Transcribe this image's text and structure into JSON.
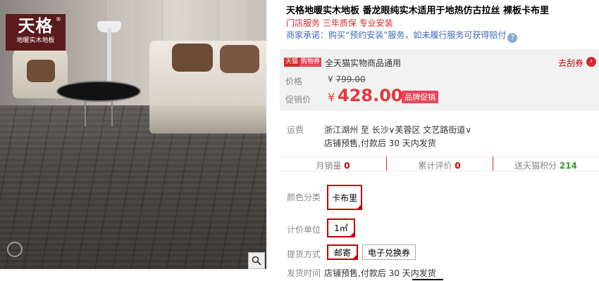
{
  "gallery": {
    "logo_main": "天格",
    "logo_sub": "地暖实木地板",
    "logo_reg": "®",
    "zoom_icon": "magnifier-icon"
  },
  "product": {
    "title": "天格地暖实木地板 番龙眼纯实木适用于地热仿古拉丝 裸板卡布里",
    "subtitle": "门店服务 三年质保 专业安装",
    "promise": "商家承诺：购买“预约安装”服务，如未履行服务可获得赔付",
    "help_icon": "?"
  },
  "price": {
    "badge_a": "天猫",
    "badge_b": "购物券",
    "coupon_text": "全天猫实物商品通用",
    "coupon_link": "去刮券",
    "coupon_arrow": "›",
    "label_price": "价格",
    "currency": "¥",
    "old_price": "799.00",
    "label_promo": "促销价",
    "promo_price": "428.00",
    "promo_tag": "品牌促销"
  },
  "shipping": {
    "label": "运费",
    "route": "浙江湖州 至 长沙∨芙蓉区 文艺路街道∨",
    "note": "店铺预售,付款后 30 天内发货"
  },
  "stats": {
    "monthly_label": "月销量",
    "monthly_value": "0",
    "reviews_label": "累计评价",
    "reviews_value": "0",
    "points_label": "送天猫积分",
    "points_value": "214"
  },
  "options": {
    "color_label": "颜色分类",
    "color_value": "卡布里",
    "unit_label": "计价单位",
    "unit_value": "1㎡",
    "pickup_label": "提货方式",
    "pickup_selected": "邮寄",
    "pickup_other": "电子兑换券",
    "delivery_label": "发货时间",
    "delivery_value": "店铺预售,付款后 30 天内发货"
  },
  "colors": {
    "accent_red": "#c40000",
    "brand_dark": "#5b1a1d",
    "link_blue": "#3a6bb5",
    "points_green": "#359a2b"
  }
}
